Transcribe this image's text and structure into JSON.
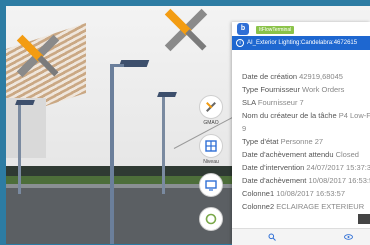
{
  "scene": {
    "colors": {
      "frame": "#2d7ca3",
      "lamp": "#3d4f6c",
      "tool_orange": "#f39c12"
    }
  },
  "toolbar": {
    "items": [
      {
        "icon": "wrench-screwdriver-icon",
        "label": "GMAO"
      },
      {
        "icon": "layers-icon",
        "label": "Niveau"
      },
      {
        "icon": "monitor-icon",
        "label": ""
      },
      {
        "icon": "circle-icon",
        "label": ""
      }
    ]
  },
  "panel": {
    "badge": "ItFlowTerminal",
    "app_icon_glyph": "b",
    "title": "AI_Exterior Lighting:Candelabra:4672615",
    "fields": [
      {
        "label": "Date de création",
        "value": "42919,68045"
      },
      {
        "label": "Type Fournisseur",
        "value": "Work Orders"
      },
      {
        "label": "SLA",
        "value": "Fournisseur 7"
      },
      {
        "label": "Nom du créateur de la tâche",
        "value": "P4 Low-Fi"
      },
      {
        "label": "",
        "value": "9"
      },
      {
        "label": "Type d'état",
        "value": "Personne 27"
      },
      {
        "label": "Date d'achèvement attendu",
        "value": "Closed"
      },
      {
        "label": "Date d'intervention",
        "value": "24/07/2017 15:37:3"
      },
      {
        "label": "Date d'achèvement",
        "value": "10/08/2017 16:53:5"
      },
      {
        "label": "Colonne1",
        "value": "10/08/2017 16:53:57"
      },
      {
        "label": "Colonne2",
        "value": "ECLAIRAGE EXTERIEUR"
      }
    ]
  }
}
